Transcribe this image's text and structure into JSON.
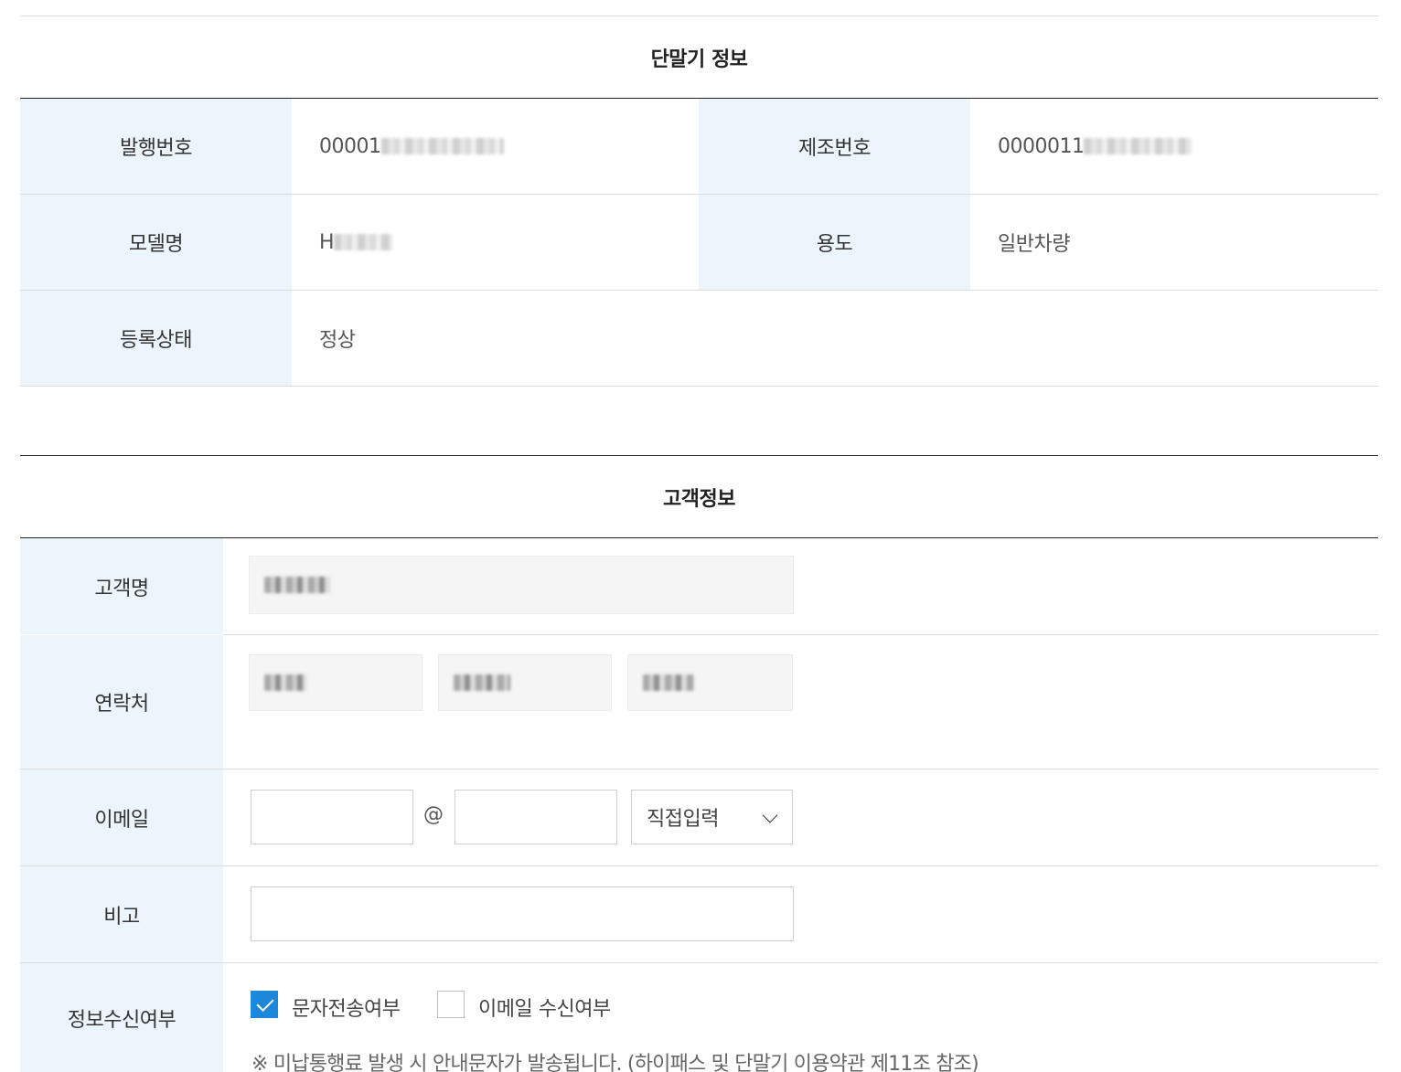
{
  "device_section": {
    "title": "단말기 정보",
    "rows": [
      {
        "label": "발행번호",
        "value": "00001",
        "label2": "제조번호",
        "value2": "0000011"
      },
      {
        "label": "모델명",
        "value": "H",
        "label2": "용도",
        "value2": "일반차량"
      },
      {
        "label": "등록상태",
        "value": "정상"
      }
    ]
  },
  "customer_section": {
    "title": "고객정보",
    "name_label": "고객명",
    "contact_label": "연락처",
    "email_label": "이메일",
    "email_at": "@",
    "email_domain_select": "직접입력",
    "note_label": "비고",
    "receive_label": "정보수신여부",
    "sms_option": "문자전송여부",
    "sms_checked": true,
    "email_option": "이메일 수신여부",
    "email_checked": false,
    "notice": "※ 미납통행료 발생 시 안내문자가 발송됩니다. (하이패스 및 단말기 이용약관 제11조 참조)"
  },
  "colors": {
    "header_bg": "#edf5fc",
    "accent": "#1e88d8"
  }
}
